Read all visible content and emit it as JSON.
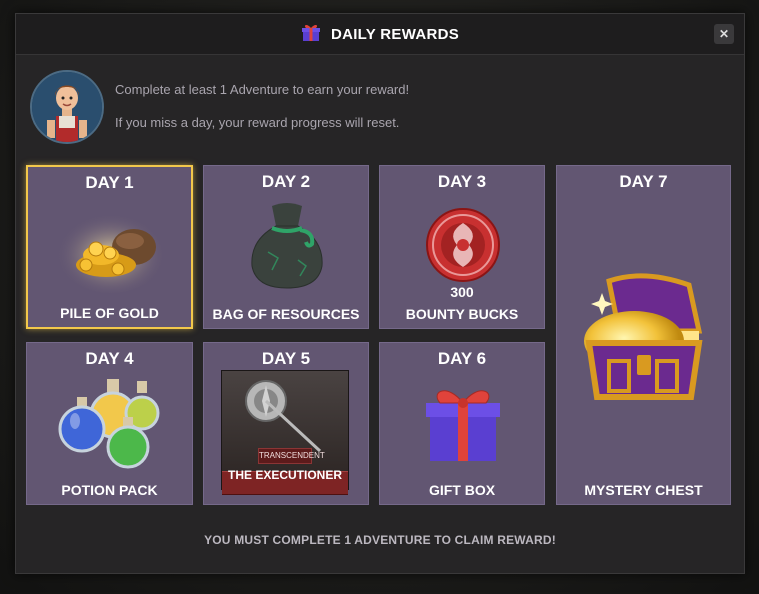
{
  "window": {
    "title": "DAILY REWARDS",
    "close_label": "✕"
  },
  "info": {
    "line1": "Complete at least 1 Adventure to earn your reward!",
    "line2": "If you miss a day, your reward progress will reset."
  },
  "rewards": [
    {
      "day": "DAY 1",
      "name": "PILE OF GOLD",
      "icon": "gold-pile-icon",
      "selected": true
    },
    {
      "day": "DAY 2",
      "name": "BAG OF RESOURCES",
      "icon": "resource-bag-icon"
    },
    {
      "day": "DAY 3",
      "name": "BOUNTY BUCKS",
      "quantity": "300",
      "icon": "bounty-bucks-icon"
    },
    {
      "day": "DAY 7",
      "name": "MYSTERY CHEST",
      "icon": "treasure-chest-icon"
    },
    {
      "day": "DAY 4",
      "name": "POTION PACK",
      "icon": "potion-pack-icon"
    },
    {
      "day": "DAY 5",
      "name": "THE EXECUTIONER",
      "tag": "TRANSCENDENT",
      "icon": "executioner-hero-icon"
    },
    {
      "day": "DAY 6",
      "name": "GIFT BOX",
      "icon": "gift-box-icon"
    }
  ],
  "footer": {
    "message": "YOU MUST COMPLETE 1 ADVENTURE TO CLAIM REWARD!"
  },
  "colors": {
    "card": "#625672",
    "selected_border": "#f2c84b",
    "dialog": "#262526"
  }
}
